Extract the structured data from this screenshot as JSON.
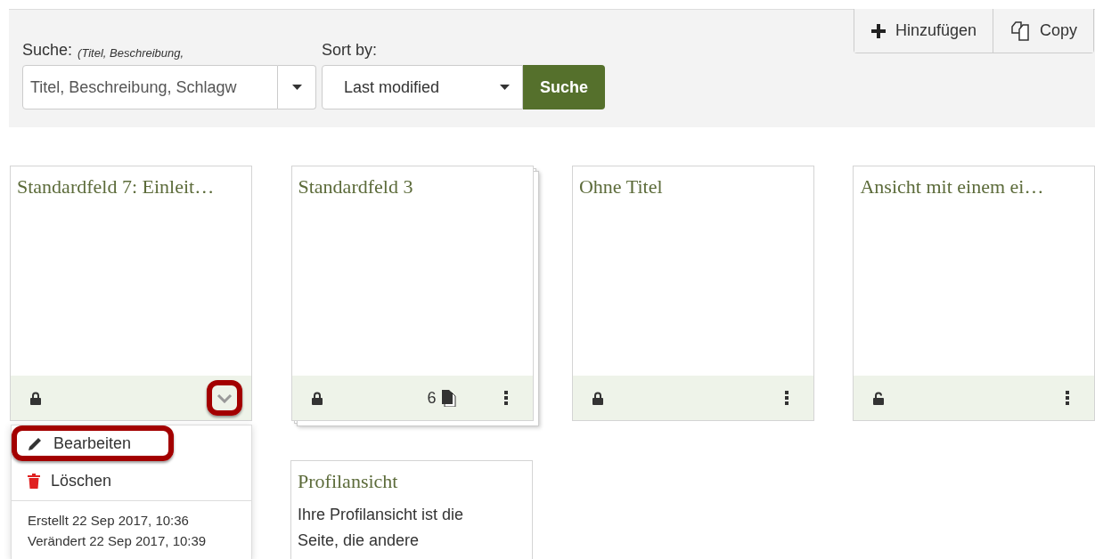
{
  "search": {
    "label": "Suche:",
    "hint": "(Titel, Beschreibung,",
    "placeholder": "Titel, Beschreibung, Schlagw"
  },
  "sort": {
    "label": "Sort by:",
    "value": "Last modified"
  },
  "search_button": "Suche",
  "actions": [
    {
      "label": "Hinzufügen",
      "kind": "add"
    },
    {
      "label": "Copy",
      "kind": "copy"
    }
  ],
  "cards": [
    {
      "title": "Standardfeld 7: Einleit…",
      "locked": true,
      "stacked": false,
      "expanded": true,
      "highlighted": true
    },
    {
      "title": "Standardfeld 3",
      "locked": true,
      "stacked": true,
      "expanded": false,
      "highlighted": false,
      "count": "6"
    },
    {
      "title": "Ohne Titel",
      "locked": true,
      "stacked": false,
      "expanded": false,
      "highlighted": false
    },
    {
      "title": "Ansicht mit einem ei…",
      "locked": false,
      "stacked": false,
      "expanded": false,
      "highlighted": false
    }
  ],
  "card_menu": {
    "items": [
      {
        "label": "Bearbeiten",
        "kind": "edit",
        "highlighted": true
      },
      {
        "label": "Löschen",
        "kind": "delete",
        "highlighted": false
      }
    ],
    "info": [
      "Erstellt 22 Sep 2017, 10:36",
      "Verändert 22 Sep 2017, 10:39"
    ]
  },
  "profile_card": {
    "title": "Profilansicht",
    "description": "Ihre Profilansicht ist die Seite, die andere"
  }
}
